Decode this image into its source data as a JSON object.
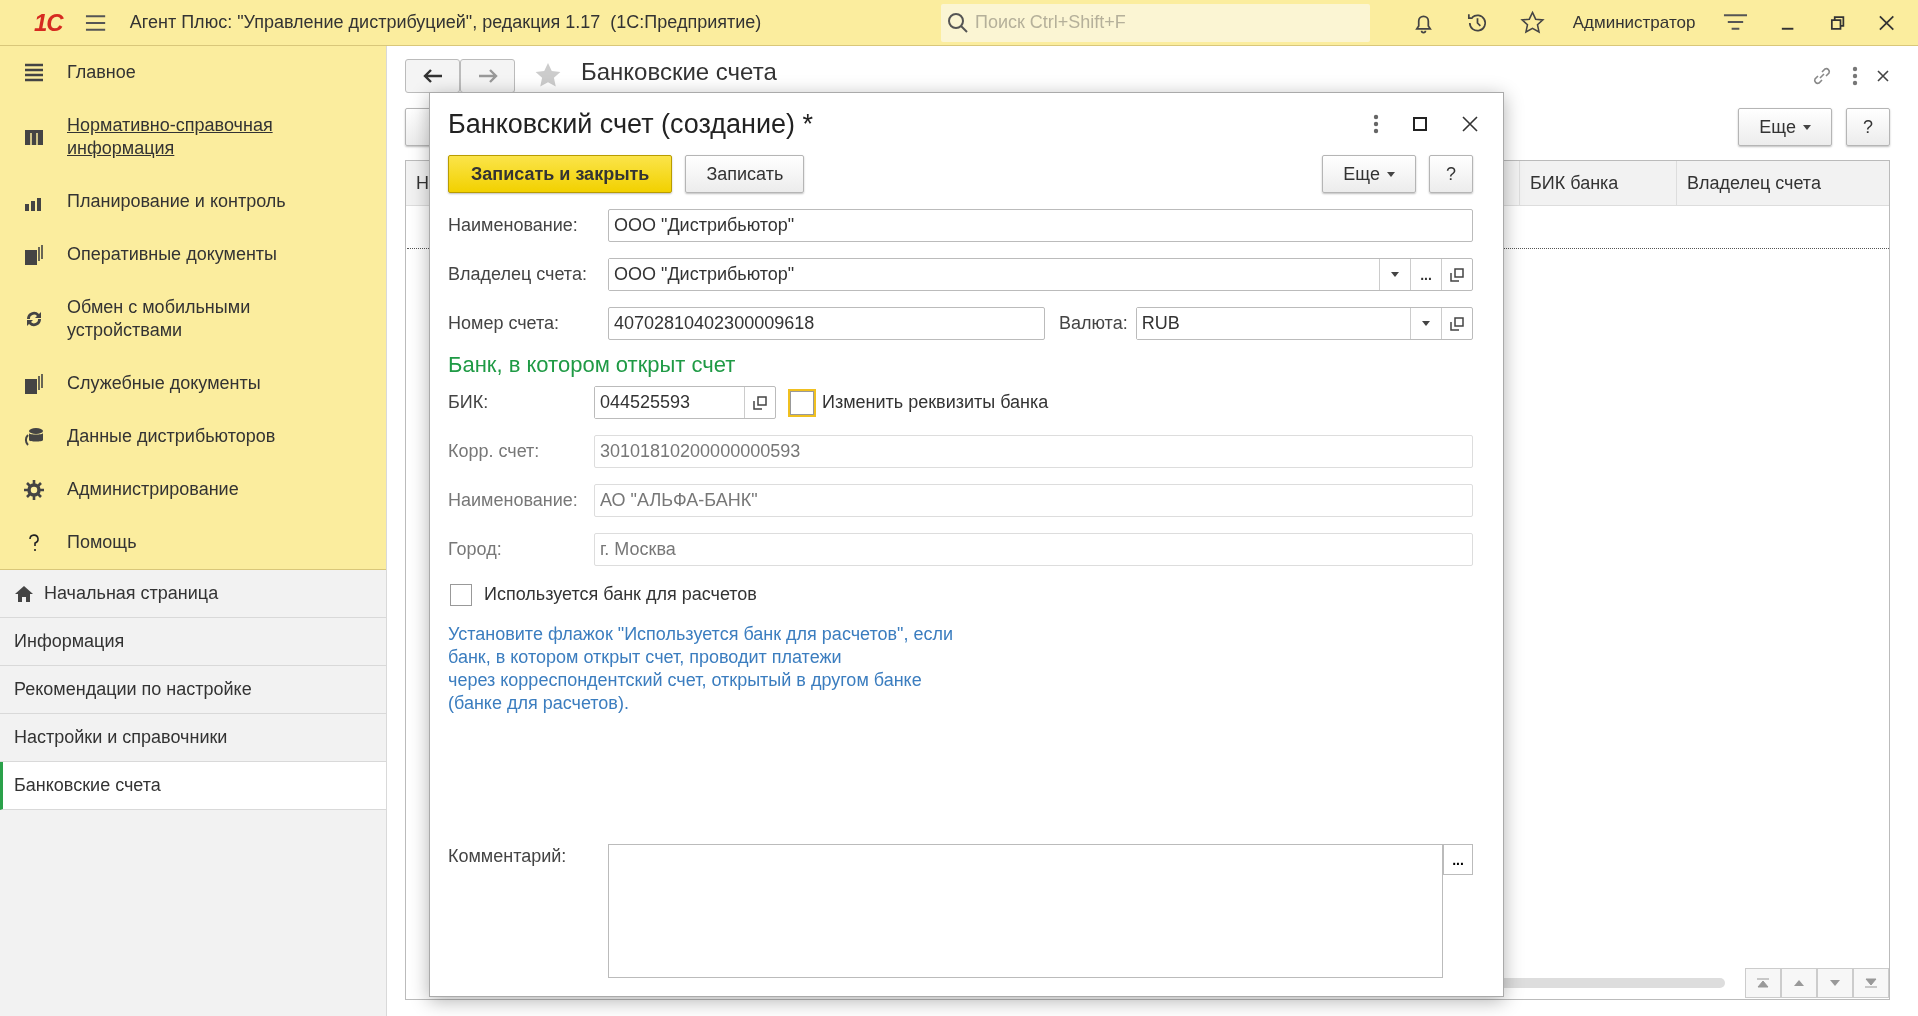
{
  "window": {
    "logo": "1С",
    "title": "Агент Плюс: \"Управление дистрибуцией\", редакция 1.17  (1С:Предприятие)",
    "user": "Администратор"
  },
  "search": {
    "placeholder": "Поиск Ctrl+Shift+F"
  },
  "sections": [
    {
      "label": "Главное",
      "selected": false
    },
    {
      "label": "Нормативно-справочная информация",
      "selected": true
    },
    {
      "label": "Планирование и контроль",
      "selected": false
    },
    {
      "label": "Оперативные документы",
      "selected": false
    },
    {
      "label": "Обмен с мобильными устройствами",
      "selected": false
    },
    {
      "label": "Служебные документы",
      "selected": false
    },
    {
      "label": "Данные дистрибьюторов",
      "selected": false
    },
    {
      "label": "Администрирование",
      "selected": false
    },
    {
      "label": "Помощь",
      "selected": false
    }
  ],
  "open_windows": [
    {
      "label": "Начальная страница",
      "kind": "home",
      "selected": false
    },
    {
      "label": "Информация",
      "kind": "page",
      "selected": false
    },
    {
      "label": "Рекомендации по настройке",
      "kind": "page",
      "selected": false
    },
    {
      "label": "Настройки и справочники",
      "kind": "page",
      "selected": false
    },
    {
      "label": "Банковские счета",
      "kind": "page",
      "selected": true
    }
  ],
  "list_form": {
    "title": "Банковские счета",
    "more": "Еще",
    "help": "?",
    "columns": [
      "Н",
      "БИК банка",
      "Владелец счета"
    ]
  },
  "dialog": {
    "title": "Банковский счет (создание) *",
    "buttons": [
      {
        "label": "Записать и закрыть",
        "kind": "primary"
      },
      {
        "label": "Записать",
        "kind": "normal"
      }
    ],
    "more": "Еще",
    "help": "?",
    "name": {
      "label": "Наименование:",
      "value": "ООО \"Дистрибьютор\""
    },
    "owner": {
      "label": "Владелец счета:",
      "value": "ООО \"Дистрибьютор\""
    },
    "account": {
      "label": "Номер счета:",
      "value": "40702810402300009618"
    },
    "currency": {
      "label": "Валюта:",
      "value": "RUB"
    },
    "bank_section": "Банк, в котором открыт счет",
    "bik": {
      "label": "БИК:",
      "value": "044525593"
    },
    "change_bank": {
      "label": "Изменить реквизиты банка",
      "checked": false
    },
    "bank_fields": [
      {
        "label": "Корр. счет:",
        "value": "30101810200000000593",
        "disabled": true
      },
      {
        "label": "Наименование:",
        "value": "АО \"АЛЬФА-БАНК\"",
        "disabled": true
      },
      {
        "label": "Город:",
        "value": "г. Москва",
        "disabled": true
      }
    ],
    "settlement_bank": {
      "label": "Используется банк для расчетов",
      "checked": false
    },
    "hint": "Установите флажок \"Используется банк для расчетов\", если\nбанк, в котором открыт счет, проводит платежи\nчерез корреспондентский счет, открытый в другом банке\n(банке для расчетов).",
    "comment": {
      "label": "Комментарий:",
      "ellipsis": "..."
    },
    "owner_ellipsis": "..."
  }
}
